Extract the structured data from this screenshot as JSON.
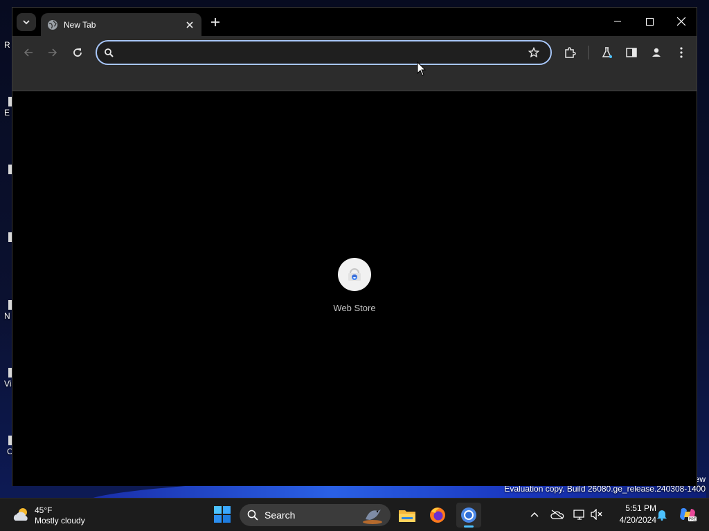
{
  "desktop": {
    "labels": [
      "R",
      "E",
      "N",
      "Vis",
      "C"
    ],
    "watermark_edge": "ew",
    "watermark": "Evaluation copy. Build 26080.ge_release.240308-1400"
  },
  "browser": {
    "tab": {
      "title": "New Tab"
    },
    "omnibox": {
      "value": "",
      "placeholder": ""
    },
    "shortcuts": [
      {
        "label": "Web Store"
      }
    ]
  },
  "taskbar": {
    "weather": {
      "temp": "45°F",
      "condition": "Mostly cloudy"
    },
    "search_label": "Search",
    "clock": {
      "time": "5:51 PM",
      "date": "4/20/2024"
    }
  },
  "colors": {
    "omnibox_focus_ring": "#a8c7fa",
    "toolbar_bg": "#2c2c2c",
    "page_bg": "#000000",
    "taskbar_active_indicator": "#4cc2ff"
  },
  "icons": {
    "tab_search": "chevron-down-icon",
    "favicon": "globe-icon",
    "close": "close-icon",
    "new_tab": "plus-icon",
    "back": "arrow-left-icon",
    "forward": "arrow-right-icon",
    "reload": "reload-icon",
    "omnibox_search": "search-icon",
    "bookmark": "star-icon",
    "extensions": "puzzle-icon",
    "labs": "flask-icon",
    "side_panel": "side-panel-icon",
    "profile": "person-icon",
    "menu": "kebab-menu-icon"
  }
}
